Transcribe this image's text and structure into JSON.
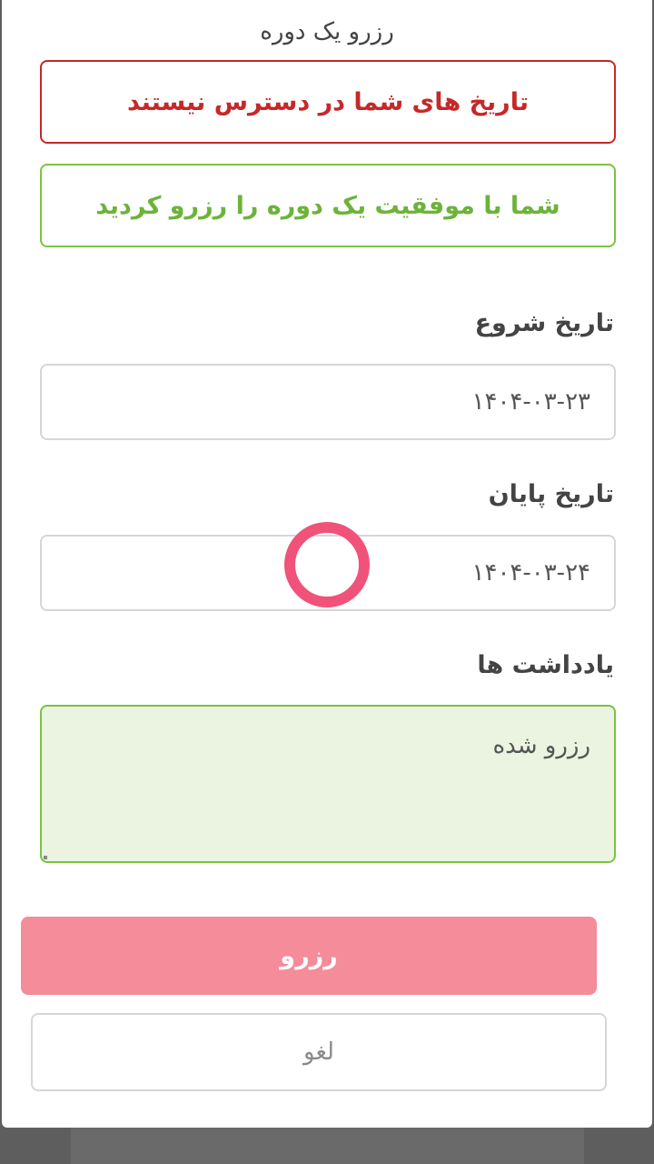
{
  "dialog": {
    "title": "رزرو یک دوره"
  },
  "alerts": {
    "error": "تاریخ های شما در دسترس نیستند",
    "success": "شما با موفقیت یک دوره را رزرو کردید"
  },
  "form": {
    "start_date": {
      "label": "تاریخ شروع",
      "value": "۱۴۰۴-۰۳-۲۳"
    },
    "end_date": {
      "label": "تاریخ پایان",
      "value": "۱۴۰۴-۰۳-۲۴"
    },
    "notes": {
      "label": "یادداشت ها",
      "value": "رزرو شده"
    }
  },
  "buttons": {
    "submit_label": "رزرو",
    "cancel_label": "لغو"
  },
  "colors": {
    "error": "#c62828",
    "success": "#7cc242",
    "submit_bg": "#f48c99",
    "touch_indicator": "#f0527a"
  }
}
